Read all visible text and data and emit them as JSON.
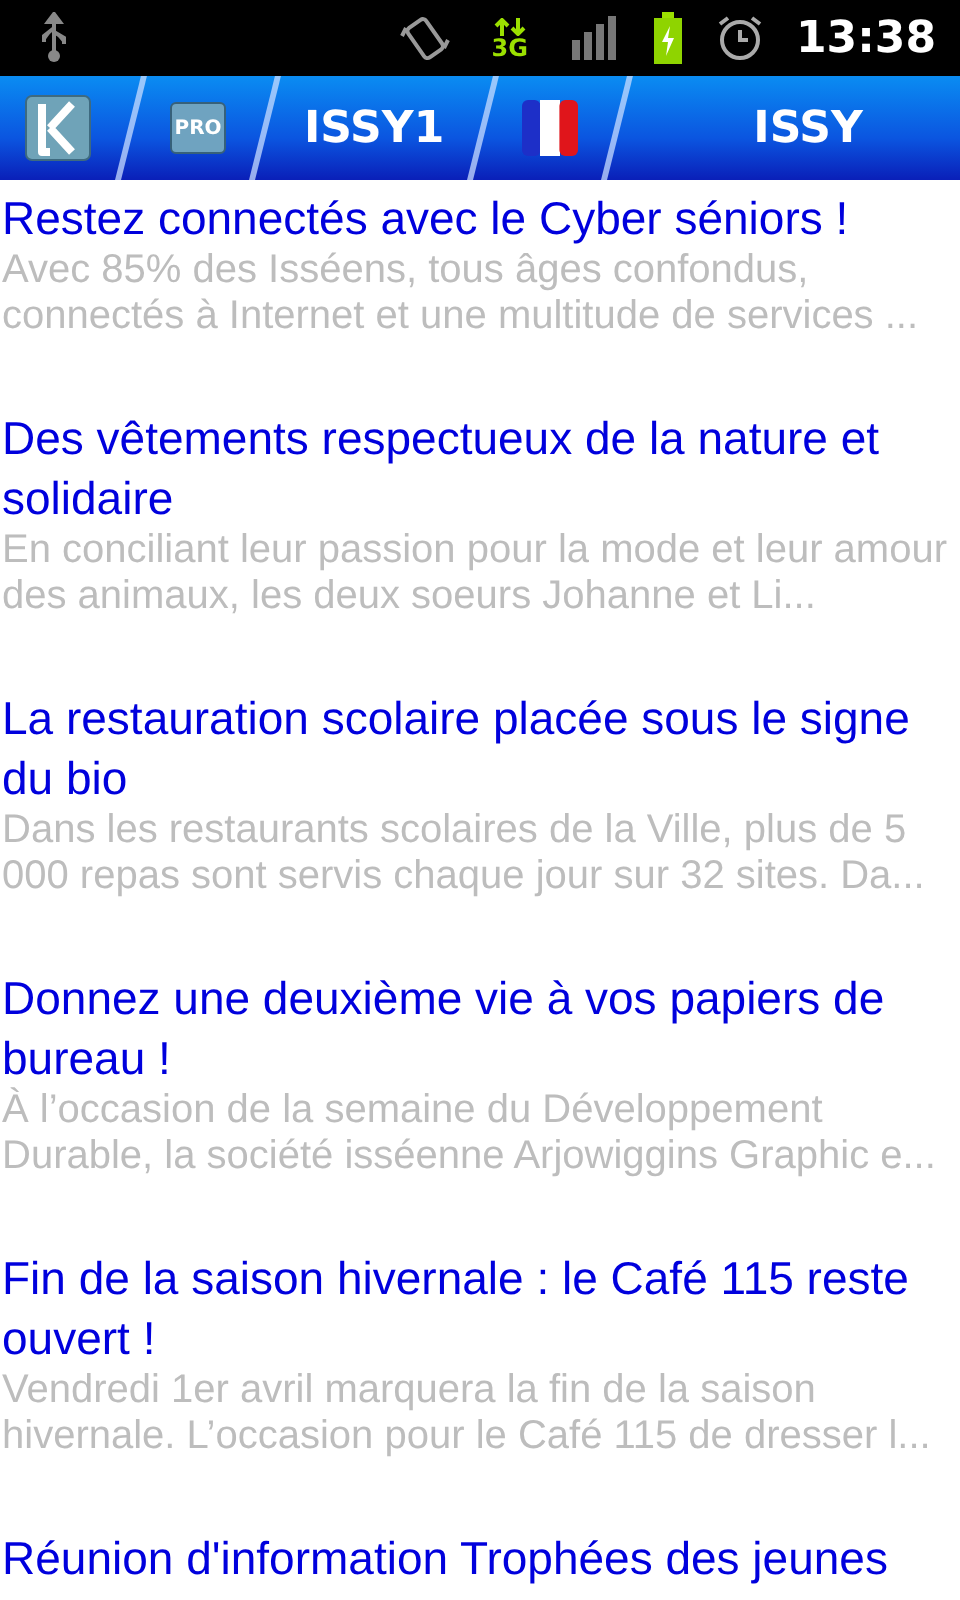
{
  "status_bar": {
    "network": "3G",
    "time": "13:38"
  },
  "action_bar": {
    "tabs": [
      {
        "kind": "logo"
      },
      {
        "kind": "pro",
        "label": "PRO"
      },
      {
        "kind": "text",
        "label": "ISSY1"
      },
      {
        "kind": "flag"
      }
    ],
    "title": "ISSY"
  },
  "articles": [
    {
      "title": "Restez connectés avec le Cyber séniors !",
      "summary": "Avec 85% des Isséens, tous âges confondus, connectés à Internet et une multitude de services ..."
    },
    {
      "title": "Des vêtements respectueux de la nature et solidaire",
      "summary": "En conciliant leur passion pour la mode et leur amour des animaux, les deux soeurs Johanne et Li..."
    },
    {
      "title": "La restauration scolaire placée sous le signe du bio",
      "summary": "Dans les restaurants scolaires de la Ville, plus de 5 000 repas sont servis chaque jour sur 32 sites. Da..."
    },
    {
      "title": "Donnez une deuxième vie à vos papiers de bureau !",
      "summary": "À l’occasion de la semaine du Développement Durable, la société isséenne Arjowiggins Graphic e..."
    },
    {
      "title": "Fin de la saison hivernale : le Café 115 reste ouvert !",
      "summary": "Vendredi 1er avril marquera la fin de la saison hivernale. L’occasion pour le Café 115 de dresser l..."
    },
    {
      "title": "Réunion d'information Trophées des jeunes"
    }
  ]
}
